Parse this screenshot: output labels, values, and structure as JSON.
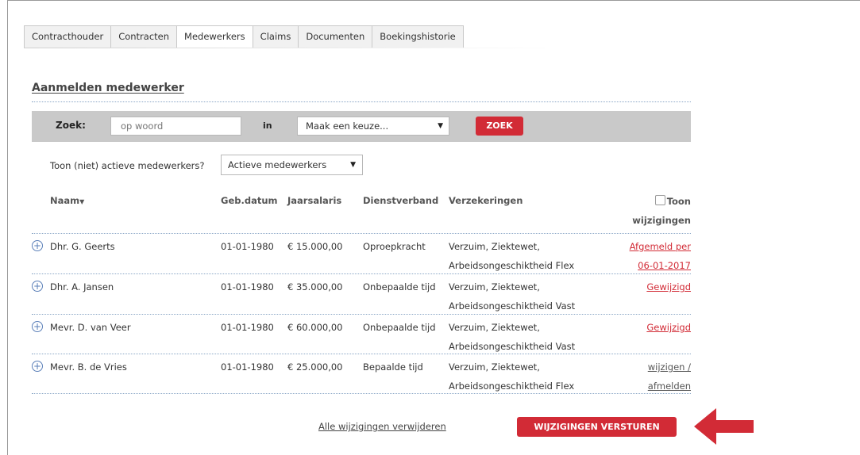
{
  "tabs": [
    "Contracthouder",
    "Contracten",
    "Medewerkers",
    "Claims",
    "Documenten",
    "Boekingshistorie"
  ],
  "active_tab": "Medewerkers",
  "section_title": "Aanmelden medewerker",
  "search": {
    "label": "Zoek:",
    "placeholder": "op woord",
    "in_label": "in",
    "select_value": "Maak een keuze...",
    "button": "ZOEK"
  },
  "filter": {
    "label": "Toon (niet) actieve medewerkers?",
    "value": "Actieve medewerkers"
  },
  "table": {
    "headers": {
      "naam": "Naam",
      "geb": "Geb.datum",
      "salaris": "Jaarsalaris",
      "dienst": "Dienstverband",
      "verz": "Verzekeringen",
      "toon1": "Toon",
      "toon2": "wijzigingen"
    },
    "rows": [
      {
        "naam": "Dhr. G. Geerts",
        "geb": "01-01-1980",
        "salaris": "€ 15.000,00",
        "dienst": "Oproepkracht",
        "verz1": "Verzuim, Ziektewet,",
        "verz2": "Arbeidsongeschiktheid Flex",
        "status1": "Afgemeld per",
        "status2": "06-01-2017"
      },
      {
        "naam": "Dhr. A. Jansen",
        "geb": "01-01-1980",
        "salaris": "€ 35.000,00",
        "dienst": "Onbepaalde tijd",
        "verz1": "Verzuim, Ziektewet,",
        "verz2": "Arbeidsongeschiktheid Vast",
        "status1": "Gewijzigd",
        "status2": ""
      },
      {
        "naam": "Mevr. D. van Veer",
        "geb": "01-01-1980",
        "salaris": "€ 60.000,00",
        "dienst": "Onbepaalde tijd",
        "verz1": "Verzuim, Ziektewet,",
        "verz2": "Arbeidsongeschiktheid Vast",
        "status1": "Gewijzigd",
        "status2": ""
      },
      {
        "naam": "Mevr. B. de Vries",
        "geb": "01-01-1980",
        "salaris": "€ 25.000,00",
        "dienst": "Bepaalde tijd",
        "verz1": "Verzuim, Ziektewet,",
        "verz2": "Arbeidsongeschiktheid Flex",
        "status1": "wijzigen /",
        "status2": "afmelden"
      }
    ]
  },
  "footer": {
    "remove_all": "Alle wijzigingen verwijderen",
    "send": "WIJZIGINGEN VERSTUREN"
  },
  "colors": {
    "accent": "#d22b36",
    "searchbar_bg": "#c9c9c9",
    "link_blue": "#5a7fb8"
  },
  "icons": [
    "plus-circle-icon",
    "caret-down-icon",
    "sort-down-icon",
    "checkbox-icon",
    "red-arrow-left-icon"
  ]
}
